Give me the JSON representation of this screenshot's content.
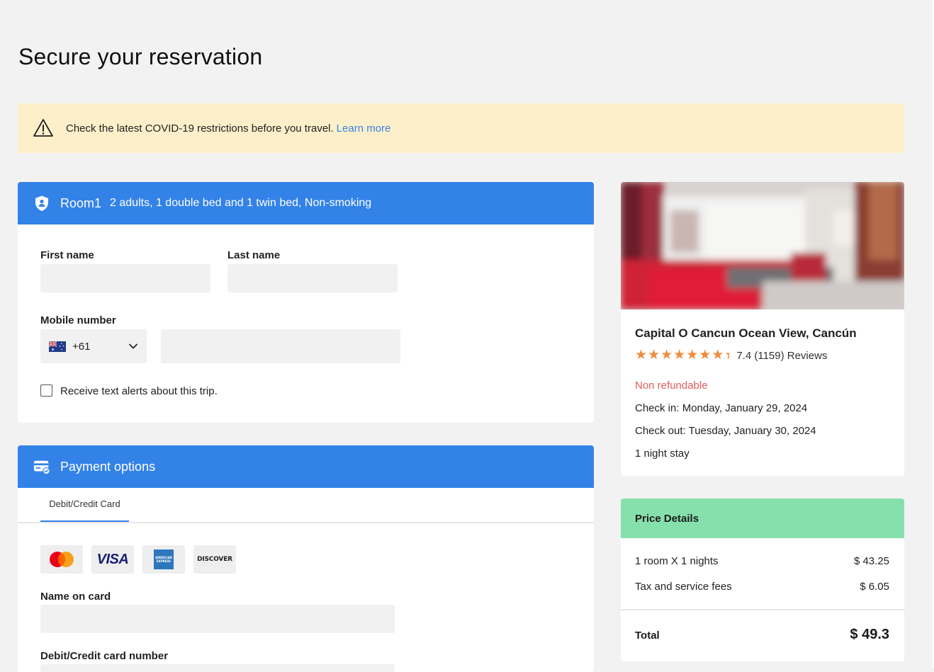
{
  "page": {
    "title": "Secure your reservation"
  },
  "covid": {
    "message": "Check the latest COVID-19 restrictions before you travel.",
    "link": "Learn more"
  },
  "room": {
    "title": "Room1",
    "subtitle": "2 adults, 1 double bed and 1 twin bed, Non-smoking",
    "first_name_label": "First name",
    "last_name_label": "Last name",
    "mobile_label": "Mobile number",
    "country_code": "+61",
    "alerts_label": "Receive text alerts about this trip."
  },
  "payment": {
    "title": "Payment options",
    "tab": "Debit/Credit Card",
    "card_brands": [
      "mastercard-icon",
      "visa-icon",
      "amex-icon",
      "discover-icon"
    ],
    "visa_text": "VISA",
    "amex_text": "AMERICAN EXPRESS",
    "discover_text": "DISCOVER",
    "name_label": "Name on card",
    "number_label": "Debit/Credit card number"
  },
  "hotel": {
    "name": "Capital O Cancun Ocean View, Cancún",
    "star_count": 7.5,
    "rating": "7.4 (1159) Reviews",
    "refund": "Non refundable",
    "check_in": "Check in: Monday, January 29, 2024",
    "check_out": "Check out: Tuesday, January 30, 2024",
    "stay": "1 night stay"
  },
  "price": {
    "title": "Price Details",
    "room_label": "1 room X 1 nights",
    "room_value": "$ 43.25",
    "tax_label": "Tax and service fees",
    "tax_value": "$ 6.05",
    "total_label": "Total",
    "total_value": "$ 49.3"
  },
  "colors": {
    "primary": "#3282e8",
    "banner": "#fcefc9",
    "price_header": "#86e0ab",
    "warning_text": "#e45b5b",
    "star": "#f08c3c",
    "link": "#3b82e6"
  }
}
